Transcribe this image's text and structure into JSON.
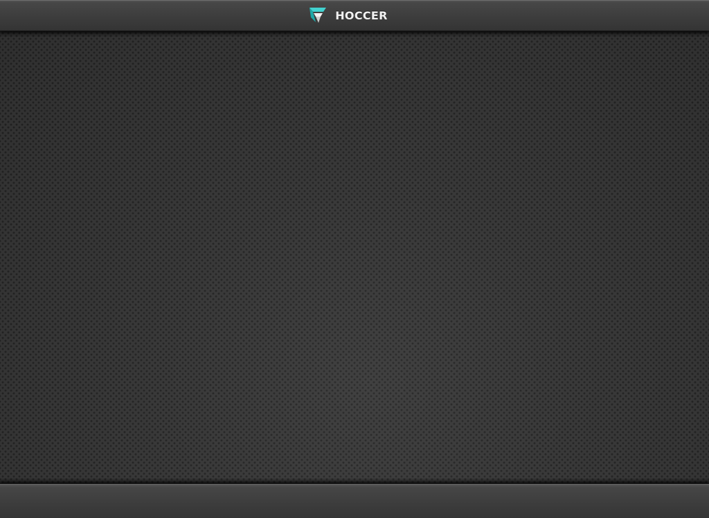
{
  "app": {
    "title": "HOCCER",
    "logo_icon": "hoccer-logo-icon",
    "accent_color": "#35c6c4"
  },
  "main": {
    "content": []
  },
  "footer": {
    "items": []
  }
}
